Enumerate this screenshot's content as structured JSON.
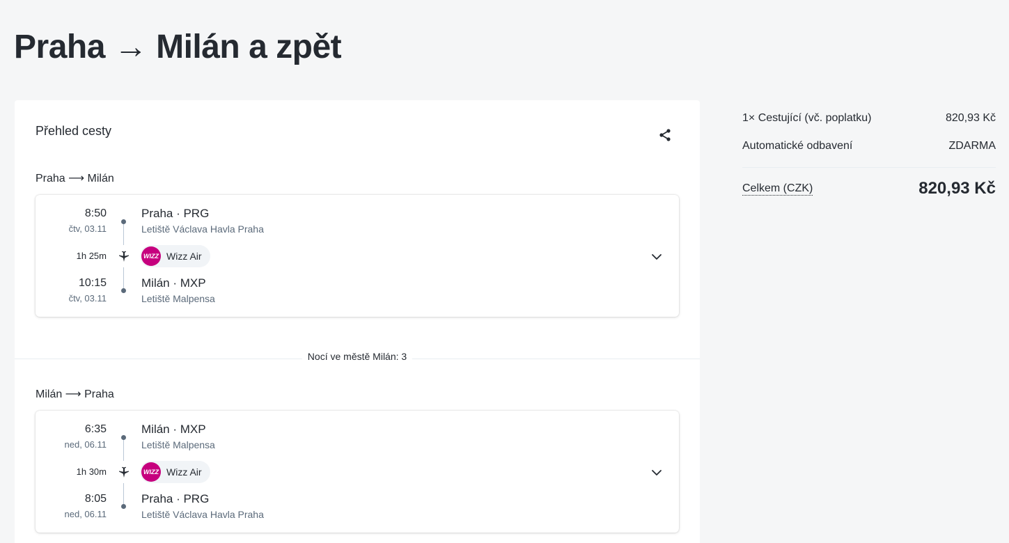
{
  "page": {
    "title": "Praha → Milán a zpět"
  },
  "overview": {
    "title": "Přehled cesty",
    "share_icon": "share-icon",
    "nights_text": "Nocí ve městě Milán: 3"
  },
  "legs": [
    {
      "title": "Praha ⟶ Milán",
      "departure": {
        "time": "8:50",
        "date": "čtv, 03.11",
        "place": "Praha · PRG",
        "airport": "Letiště Václava Havla Praha"
      },
      "duration": "1h 25m",
      "carrier": {
        "name": "Wizz Air",
        "logo_text": "WIZZ"
      },
      "arrival": {
        "time": "10:15",
        "date": "čtv, 03.11",
        "place": "Milán · MXP",
        "airport": "Letiště Malpensa"
      }
    },
    {
      "title": "Milán ⟶ Praha",
      "departure": {
        "time": "6:35",
        "date": "ned, 06.11",
        "place": "Milán · MXP",
        "airport": "Letiště Malpensa"
      },
      "duration": "1h 30m",
      "carrier": {
        "name": "Wizz Air",
        "logo_text": "WIZZ"
      },
      "arrival": {
        "time": "8:05",
        "date": "ned, 06.11",
        "place": "Praha · PRG",
        "airport": "Letiště Václava Havla Praha"
      }
    }
  ],
  "price": {
    "rows": [
      {
        "label": "1× Cestující (vč. poplatku)",
        "value": "820,93 Kč"
      },
      {
        "label": "Automatické odbavení",
        "value": "ZDARMA"
      }
    ],
    "total_label": "Celkem (CZK)",
    "total_value": "820,93 Kč"
  },
  "colors": {
    "wizz_brand": "#c6007e",
    "text": "#252a31",
    "muted": "#5b6a7a",
    "background": "#f5f6f7"
  }
}
